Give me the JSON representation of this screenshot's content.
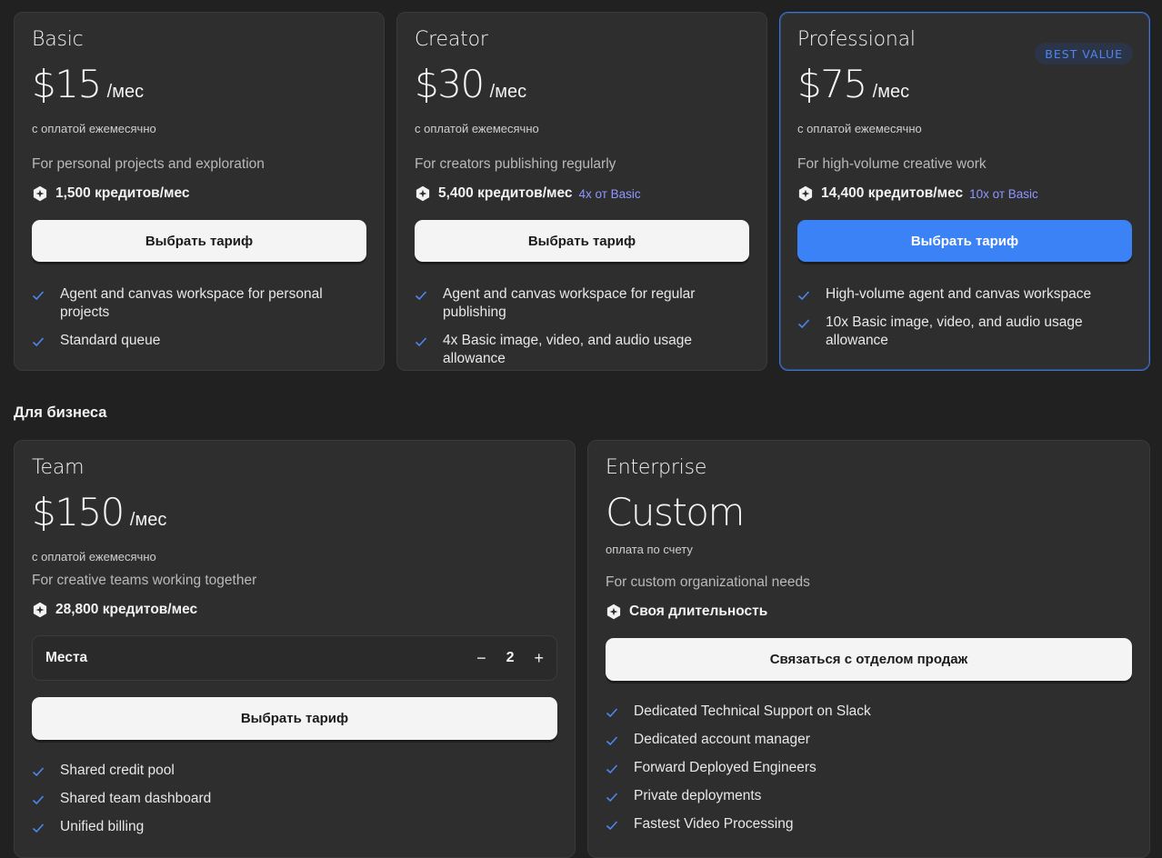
{
  "plans": [
    {
      "name": "Basic",
      "price": "$15",
      "period": "/мес",
      "billing": "с оплатой ежемесячно",
      "description": "For personal projects and exploration",
      "credits": "1,500 кредитов/мес",
      "multiplier": "",
      "button_label": "Выбрать тариф",
      "features": [
        "Agent and canvas workspace for personal projects",
        "Standard queue"
      ]
    },
    {
      "name": "Creator",
      "price": "$30",
      "period": "/мес",
      "billing": "с оплатой ежемесячно",
      "description": "For creators publishing regularly",
      "credits": "5,400 кредитов/мес",
      "multiplier": "4x от Basic",
      "button_label": "Выбрать тариф",
      "features": [
        "Agent and canvas workspace for regular publishing",
        "4x Basic image, video, and audio usage allowance"
      ]
    },
    {
      "name": "Professional",
      "price": "$75",
      "period": "/мес",
      "billing": "с оплатой ежемесячно",
      "badge": "BEST VALUE",
      "description": "For high-volume creative work",
      "credits": "14,400 кредитов/мес",
      "multiplier": "10x от Basic",
      "button_label": "Выбрать тариф",
      "features": [
        "High-volume agent and canvas workspace",
        "10x Basic image, video, and audio usage allowance"
      ]
    }
  ],
  "business_section_title": "Для бизнеса",
  "team": {
    "name": "Team",
    "price": "$150",
    "period": "/мес",
    "billing": "с оплатой ежемесячно",
    "description": "For creative teams working together",
    "credits": "28,800 кредитов/мес",
    "seats_label": "Места",
    "seats_minus": "−",
    "seats_value": "2",
    "seats_plus": "+",
    "button_label": "Выбрать тариф",
    "features": [
      "Shared credit pool",
      "Shared team dashboard",
      "Unified billing"
    ]
  },
  "enterprise": {
    "name": "Enterprise",
    "price": "Custom",
    "billing": "оплата по счету",
    "description": "For custom organizational needs",
    "credits": "Своя длительность",
    "button_label": "Связаться с отделом продаж",
    "features": [
      "Dedicated Technical Support on Slack",
      "Dedicated account manager",
      "Forward Deployed Engineers",
      "Private deployments",
      "Fastest Video Processing"
    ]
  },
  "colors": {
    "background": "#212121",
    "card": "#2e2e2e",
    "accent_blue": "#3b82f6",
    "check": "#4d86f0",
    "multiplier": "#8f97ff"
  },
  "icons": {
    "credit": "credit-hexagon-icon",
    "feature": "check-icon"
  }
}
